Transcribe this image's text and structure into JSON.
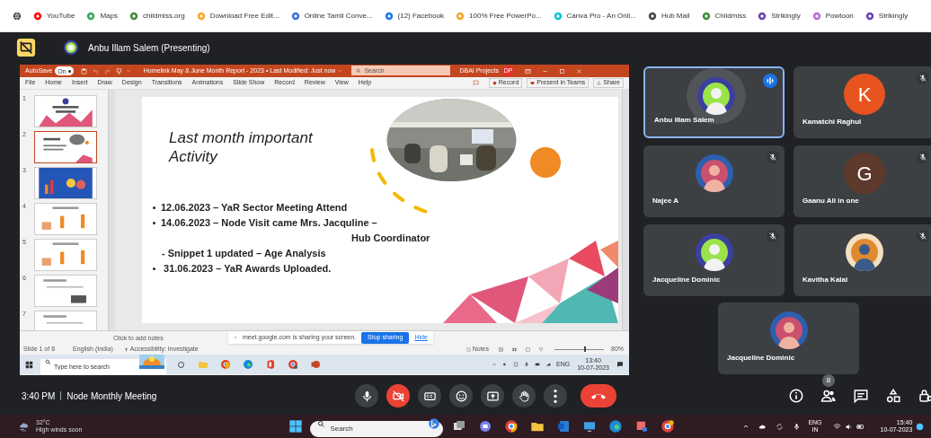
{
  "bookmarks": [
    {
      "label": "YouTube",
      "color": "#ff0000"
    },
    {
      "label": "Maps",
      "color": "#34a853"
    },
    {
      "label": "childmiss.org",
      "color": "#3c8d3c"
    },
    {
      "label": "Download Free Edit...",
      "color": "#f6a623"
    },
    {
      "label": "Online Tamil Conve...",
      "color": "#3b6fd8"
    },
    {
      "label": "(12) Facebook",
      "color": "#1877f2"
    },
    {
      "label": "100% Free PowerPo...",
      "color": "#f6a623"
    },
    {
      "label": "Canva Pro - An Onli...",
      "color": "#00c4cc"
    },
    {
      "label": "Hub Mail",
      "color": "#444444"
    },
    {
      "label": "Childmiss",
      "color": "#3c8d3c"
    },
    {
      "label": "Strikingly",
      "color": "#6a3fb5"
    },
    {
      "label": "Powtoon",
      "color": "#b56adb"
    },
    {
      "label": "Strikingly",
      "color": "#6a3fb5"
    }
  ],
  "presenter": {
    "label": "Anbu Illam Salem (Presenting)"
  },
  "ppt": {
    "autosave": {
      "label": "AutoSave",
      "toggle": "On",
      "on": true
    },
    "title": "Homelink May & June Month Report - 2023 • Last Modified: Just now",
    "search": {
      "placeholder": "Search"
    },
    "account": "DBAI Projects",
    "account_initials": "DP",
    "menu": [
      "File",
      "Home",
      "Insert",
      "Draw",
      "Design",
      "Transitions",
      "Animations",
      "Slide Show",
      "Record",
      "Review",
      "View",
      "Help"
    ],
    "record": "Record",
    "present": "Present in Teams",
    "share": "Share",
    "thumbnails": [
      {
        "number": "1",
        "selected": false,
        "kind": "title"
      },
      {
        "number": "2",
        "selected": true
      },
      {
        "number": "3",
        "selected": false,
        "kind": "blue"
      },
      {
        "number": "4",
        "selected": false,
        "kind": "chart"
      },
      {
        "number": "5",
        "selected": false,
        "kind": "chart"
      },
      {
        "number": "6",
        "selected": false,
        "kind": "plain"
      },
      {
        "number": "7",
        "selected": false,
        "kind": "plain"
      }
    ],
    "slide": {
      "title": "Last month important Activity",
      "lines": [
        {
          "kind": "bullet",
          "text": "12.06.2023 – YaR Sector Meeting Attend"
        },
        {
          "kind": "bullet",
          "text": "14.06.2023 – Node Visit came Mrs. Jacquline –"
        },
        {
          "kind": "continuation",
          "text": "Hub Coordinator"
        },
        {
          "kind": "sub",
          "text": "- Snippet 1 updated – Age Analysis"
        },
        {
          "kind": "bullet",
          "text": " 31.06.2023 – YaR Awards Uploaded."
        }
      ]
    },
    "notes": {
      "placeholder": "Click to add notes"
    },
    "share_banner": {
      "message": "meet.google.com is sharing your screen.",
      "stop": "Stop sharing",
      "hide": "Hide"
    },
    "status": {
      "slide": "Slide 1 of 8",
      "language": "English (India)",
      "accessibility": "Accessibility: Investigate",
      "notes": "Notes",
      "zoom": "80%",
      "level": 0.6
    },
    "taskbar": {
      "search": {
        "placeholder": "Type here to search"
      },
      "lang": "ENG",
      "time": "13:40",
      "date": "10-07-2023"
    }
  },
  "tiles": [
    {
      "name": "Anbu Illam Salem",
      "kind": "picture",
      "speaking": true,
      "muted": false
    },
    {
      "name": "Kamatchi Raghul",
      "kind": "letter",
      "letter": "K",
      "color": "#e8541f",
      "speaking": false,
      "muted": true
    },
    {
      "name": "Najee A",
      "kind": "picture",
      "speaking": false,
      "muted": true
    },
    {
      "name": "Gaanu All in one",
      "kind": "letter",
      "letter": "G",
      "color": "#5d3a2c",
      "speaking": false,
      "muted": true
    },
    {
      "name": "Jacqueline Dominic",
      "kind": "picture",
      "speaking": false,
      "muted": true
    },
    {
      "name": "Kavitha Kalai",
      "kind": "picture",
      "speaking": false,
      "muted": true
    },
    {
      "name": "Jacqueline Dominic",
      "kind": "picture",
      "speaking": false,
      "muted": false
    }
  ],
  "meeting": {
    "time": "3:40 PM",
    "title": "Node Monthly Meeting",
    "controls": [
      {
        "kind": "mic",
        "on": true
      },
      {
        "kind": "camera",
        "on": false
      },
      {
        "kind": "captions"
      },
      {
        "kind": "emoji"
      },
      {
        "kind": "present"
      },
      {
        "kind": "hand"
      },
      {
        "kind": "more"
      },
      {
        "kind": "leave"
      }
    ],
    "right": [
      {
        "kind": "info"
      },
      {
        "kind": "people",
        "badge": "8"
      },
      {
        "kind": "chat"
      },
      {
        "kind": "activities"
      },
      {
        "kind": "lock"
      }
    ]
  },
  "windows": {
    "weather": {
      "temp": "32°C",
      "text": "High winds soon"
    },
    "search": {
      "placeholder": "Search"
    },
    "lang": "ENG",
    "region": "IN",
    "time": "15:40",
    "date": "10-07-2023"
  }
}
